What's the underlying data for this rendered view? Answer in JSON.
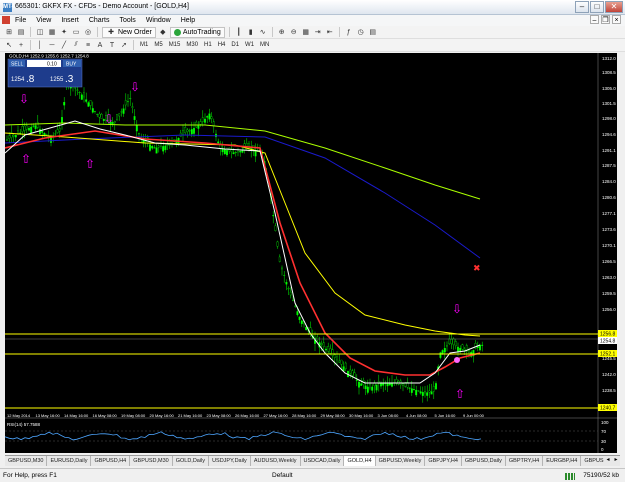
{
  "window": {
    "title": "665301: GKFX FX - CFDs - Demo Account - [GOLD,H4]",
    "app_icon": "MT4"
  },
  "menu": [
    "File",
    "View",
    "Insert",
    "Charts",
    "Tools",
    "Window",
    "Help"
  ],
  "toolbar": {
    "new_order": "New Order",
    "autotrading": "AutoTrading",
    "timeframes": [
      "M1",
      "M5",
      "M15",
      "M30",
      "H1",
      "H4",
      "D1",
      "W1",
      "MN"
    ]
  },
  "chart": {
    "symbol_label": "GOLD,H4  1252.9 1255.6 1252.7 1254.8",
    "one_click": {
      "sell_label": "SELL",
      "buy_label": "BUY",
      "lot": "0.10",
      "sell_big": "1254",
      "sell_small": ".8",
      "buy_big": "1255",
      "buy_small": ".3"
    },
    "price_labels": [
      "1312.0",
      "1308.5",
      "1305.0",
      "1301.5",
      "1298.0",
      "1294.6",
      "1291.1",
      "1287.5",
      "1284.0",
      "1280.6",
      "1277.1",
      "1273.6",
      "1270.1",
      "1266.5",
      "1263.0",
      "1259.5",
      "1256.0",
      "1249.0",
      "1245.5",
      "1242.0",
      "1238.5"
    ],
    "highlighted_prices": {
      "upper": "1256.8",
      "current": "1254.8",
      "middle": "1252.1",
      "lower": "1240.7"
    },
    "time_labels": [
      "12 May 2014",
      "13 May 16:00",
      "14 May 16:00",
      "16 May 08:00",
      "19 May 08:00",
      "20 May 16:00",
      "21 May 16:00",
      "23 May 08:00",
      "26 May 16:00",
      "27 May 16:00",
      "28 May 16:00",
      "29 May 08:00",
      "30 May 16:00",
      "3 Jun 08:00",
      "4 Jun 08:00",
      "5 Jun 16:00",
      "9 Jun 00:00"
    ],
    "rsi_label": "RSI(14) 57.7588",
    "rsi_scale": [
      "100",
      "70",
      "30",
      "0"
    ],
    "colors": {
      "background": "#000000",
      "bull": "#00ff00",
      "white_ma": "#ffffff",
      "red_ma": "#ff3030",
      "yellow_ma": "#ffff00",
      "blue_ma": "#0000cc",
      "green_ma": "#aaff00",
      "arrow": "#ff00ff",
      "level": "#ffff00"
    }
  },
  "tabs": [
    "GBPUSD,M30",
    "EURUSD,Daily",
    "GBPUSD,H4",
    "GBPUSD,M30",
    "GOLD,Daily",
    "USDJPY,Daily",
    "AUDUSD,Weekly",
    "USDCAD,Daily",
    "GOLD,H4",
    "GBPUSD,Weekly",
    "GBPJPY,H4",
    "GBPUSD,Daily",
    "GBPTRY,H4",
    "EURGBP,H4",
    "GBPUSD,Dai"
  ],
  "active_tab": "GOLD,H4",
  "status": {
    "help": "For Help, press F1",
    "profile": "Default",
    "traffic": "75190/52 kb"
  }
}
